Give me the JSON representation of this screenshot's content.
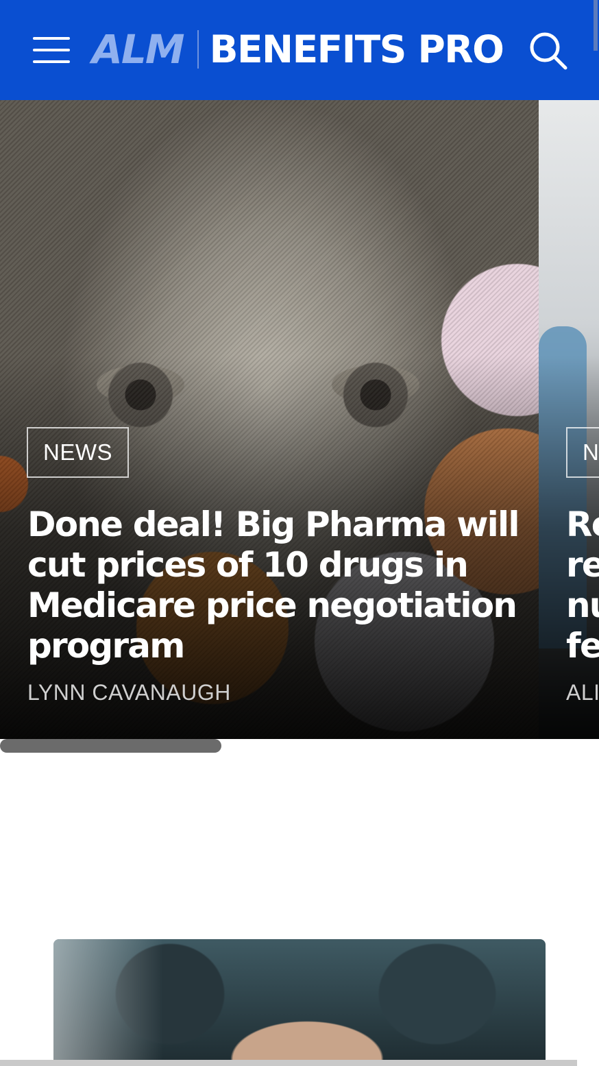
{
  "header": {
    "logo_alm": "ALM",
    "logo_brand": "BENEFITS PRO",
    "background_color": "#0a4fd1"
  },
  "carousel": {
    "slides": [
      {
        "tag": "NEWS",
        "headline": "Done deal! Big Pharma will cut prices of 10 drugs in Medicare price negotiation program",
        "author": "LYNN CAVANAUGH"
      },
      {
        "tag": "N",
        "headline": "Re\nre\nnu\nfe",
        "author": "ALI"
      }
    ]
  },
  "icons": {
    "menu": "hamburger-menu-icon",
    "search": "search-icon"
  }
}
